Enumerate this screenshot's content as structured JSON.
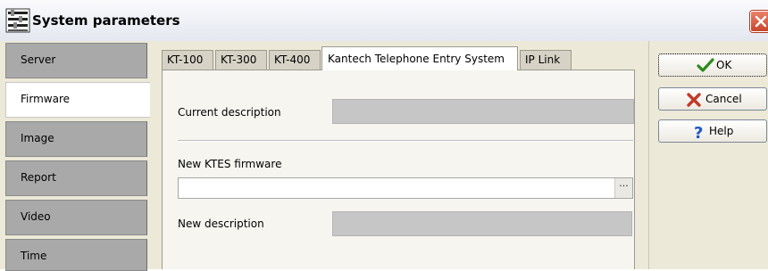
{
  "window": {
    "title": "System parameters"
  },
  "sidebar": {
    "items": [
      {
        "label": "Server",
        "active": false
      },
      {
        "label": "Firmware",
        "active": true
      },
      {
        "label": "Image",
        "active": false
      },
      {
        "label": "Report",
        "active": false
      },
      {
        "label": "Video",
        "active": false
      },
      {
        "label": "Time",
        "active": false
      }
    ]
  },
  "tabs": [
    {
      "label": "KT-100",
      "active": false
    },
    {
      "label": "KT-300",
      "active": false
    },
    {
      "label": "KT-400",
      "active": false
    },
    {
      "label": "Kantech Telephone Entry System",
      "active": true
    },
    {
      "label": "IP Link",
      "active": false
    }
  ],
  "form": {
    "current_description_label": "Current description",
    "current_description_value": "",
    "new_firmware_label": "New KTES firmware",
    "new_firmware_value": "",
    "browse_label": "···",
    "new_description_label": "New description",
    "new_description_value": ""
  },
  "buttons": {
    "ok": "OK",
    "cancel": "Cancel",
    "help": "Help"
  },
  "icons": {
    "app": "system-parameters-icon",
    "close": "close-icon",
    "ok": "checkmark-icon",
    "cancel": "x-icon",
    "help": "question-icon"
  },
  "colors": {
    "ok_check": "#2d8a1e",
    "cancel_x": "#c0392b",
    "help_question": "#1a56c9",
    "close_button": "#d9553a",
    "tab_inactive": "#a9a9a9"
  }
}
